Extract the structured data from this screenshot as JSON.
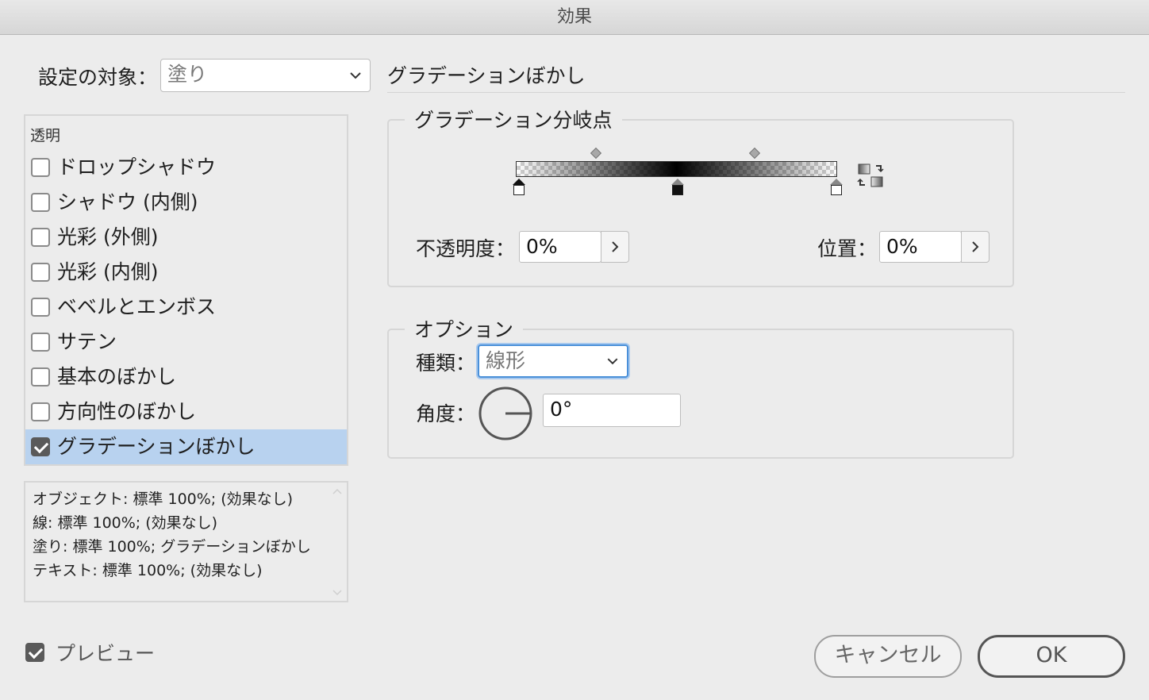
{
  "window": {
    "title": "効果"
  },
  "target": {
    "label": "設定の対象：",
    "value": "塗り"
  },
  "effects": {
    "header": "透明",
    "items": [
      {
        "label": "ドロップシャドウ",
        "checked": false
      },
      {
        "label": "シャドウ (内側)",
        "checked": false
      },
      {
        "label": "光彩 (外側)",
        "checked": false
      },
      {
        "label": "光彩 (内側)",
        "checked": false
      },
      {
        "label": "ベベルとエンボス",
        "checked": false
      },
      {
        "label": "サテン",
        "checked": false
      },
      {
        "label": "基本のぼかし",
        "checked": false
      },
      {
        "label": "方向性のぼかし",
        "checked": false
      },
      {
        "label": "グラデーションぼかし",
        "checked": true
      }
    ]
  },
  "summary": {
    "lines": [
      "オブジェクト: 標準 100%; (効果なし)",
      "線: 標準 100%; (効果なし)",
      "塗り: 標準 100%; グラデーションぼかし",
      "テキスト: 標準 100%; (効果なし)"
    ]
  },
  "panel": {
    "title": "グラデーションぼかし",
    "stops_group": {
      "legend": "グラデーション分岐点",
      "opacity_label": "不透明度：",
      "opacity_value": "0%",
      "location_label": "位置：",
      "location_value": "0%",
      "reverse_icon": "reverse-gradient-icon"
    },
    "options_group": {
      "legend": "オプション",
      "type_label": "種類：",
      "type_value": "線形",
      "angle_label": "角度：",
      "angle_value": "0°"
    }
  },
  "preview": {
    "label": "プレビュー",
    "checked": true
  },
  "buttons": {
    "cancel": "キャンセル",
    "ok": "OK"
  }
}
